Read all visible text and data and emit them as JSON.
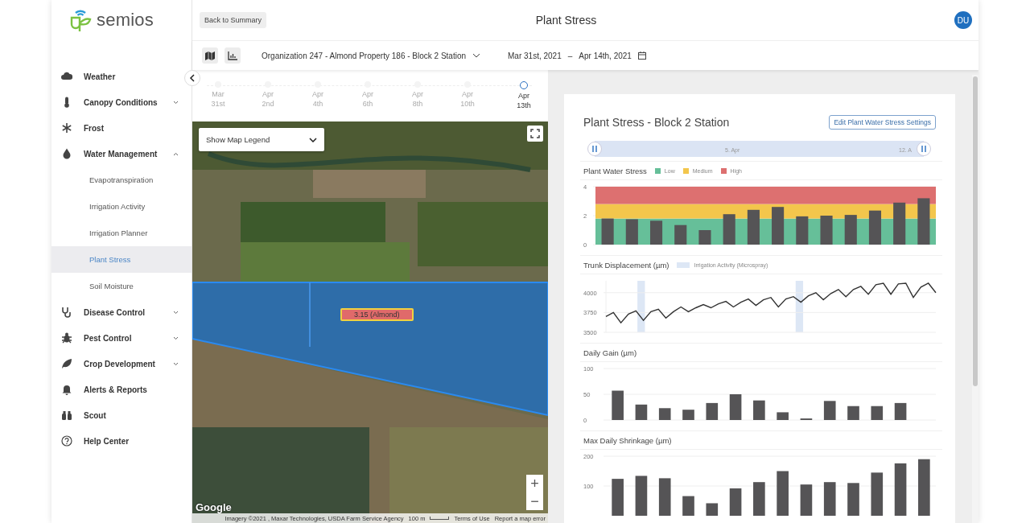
{
  "sidebar": {
    "logo_text": "semios",
    "items": [
      {
        "kind": "cloud",
        "label": "Weather",
        "has_submenu": false,
        "expanded": false
      },
      {
        "kind": "thermometer",
        "label": "Canopy Conditions",
        "has_submenu": true,
        "expanded": false
      },
      {
        "kind": "snowflake",
        "label": "Frost",
        "has_submenu": false,
        "expanded": false
      },
      {
        "kind": "drop",
        "label": "Water Management",
        "has_submenu": true,
        "expanded": true,
        "children": [
          {
            "label": "Evapotranspiration",
            "selected": false
          },
          {
            "label": "Irrigation Activity",
            "selected": false
          },
          {
            "label": "Irrigation Planner",
            "selected": false
          },
          {
            "label": "Plant Stress",
            "selected": true
          },
          {
            "label": "Soil Moisture",
            "selected": false
          }
        ]
      },
      {
        "kind": "stethoscope",
        "label": "Disease Control",
        "has_submenu": true,
        "expanded": false
      },
      {
        "kind": "bug",
        "label": "Pest Control",
        "has_submenu": true,
        "expanded": false
      },
      {
        "kind": "leaf",
        "label": "Crop Development",
        "has_submenu": true,
        "expanded": false
      },
      {
        "kind": "bell",
        "label": "Alerts & Reports",
        "has_submenu": false,
        "expanded": false
      },
      {
        "kind": "binoculars",
        "label": "Scout",
        "has_submenu": false,
        "expanded": false
      },
      {
        "kind": "help",
        "label": "Help Center",
        "has_submenu": false,
        "expanded": false
      }
    ]
  },
  "header": {
    "back_button": "Back to Summary",
    "title": "Plant Stress",
    "avatar": "DU"
  },
  "toolbar": {
    "location": "Organization 247 - Almond Property 186 - Block 2 Station",
    "date_start": "Mar 31st, 2021",
    "date_separator": "–",
    "date_end": "Apr 14th, 2021"
  },
  "timeline": [
    {
      "month": "Mar",
      "day": "31st",
      "selected": false
    },
    {
      "month": "Apr",
      "day": "2nd",
      "selected": false
    },
    {
      "month": "Apr",
      "day": "4th",
      "selected": false
    },
    {
      "month": "Apr",
      "day": "6th",
      "selected": false
    },
    {
      "month": "Apr",
      "day": "8th",
      "selected": false
    },
    {
      "month": "Apr",
      "day": "10th",
      "selected": false
    },
    {
      "month": "Apr",
      "day": "13th",
      "selected": true
    }
  ],
  "map": {
    "legend_toggle": "Show Map Legend",
    "block_label": "3.15 (Almond)",
    "zoom_in": "+",
    "zoom_out": "−",
    "provider": "Google",
    "attribution": "Imagery ©2021 , Maxar Technologies, USDA Farm Service Agency",
    "scale": "100 m",
    "terms": "Terms of Use",
    "report": "Report a map error"
  },
  "panel": {
    "title": "Plant Stress - Block 2 Station",
    "edit_button": "Edit Plant Water Stress Settings",
    "range_ticks": [
      "5. Apr",
      "12. A"
    ],
    "charts": [
      {
        "chart_data": {
          "type": "bar",
          "title": "Plant Water Stress",
          "ylim": [
            0,
            4
          ],
          "yticks": [
            0,
            2,
            4
          ],
          "categories": [
            null,
            null,
            null,
            null,
            null,
            null,
            null,
            null,
            null,
            null,
            null,
            null,
            null,
            null
          ],
          "values": [
            1.8,
            1.75,
            1.65,
            1.35,
            1.0,
            2.1,
            2.4,
            2.6,
            1.95,
            2.0,
            2.05,
            2.35,
            2.9,
            3.2
          ],
          "bands": [
            {
              "axis": "y",
              "from": 0,
              "to": 1.8,
              "label": "Low",
              "color": "#66bf99"
            },
            {
              "axis": "y",
              "from": 1.8,
              "to": 2.8,
              "label": "Medium",
              "color": "#f3c64c"
            },
            {
              "axis": "y",
              "from": 2.8,
              "to": 4,
              "label": "High",
              "color": "#dd7070"
            }
          ]
        }
      },
      {
        "legend": [
          {
            "label": "Irrigation Activity (Microspray)",
            "color": "#dde7f5"
          }
        ],
        "chart_data": {
          "type": "line",
          "title": "Trunk Displacement (µm)",
          "ylim": [
            3500,
            4150
          ],
          "yticks": [
            3500,
            3750,
            4000
          ],
          "categories": [
            null,
            null,
            null,
            null,
            null,
            null,
            null,
            null,
            null,
            null,
            null,
            null,
            null,
            null,
            null,
            null,
            null,
            null,
            null,
            null,
            null,
            null,
            null,
            null,
            null,
            null,
            null,
            null,
            null,
            null,
            null,
            null,
            null,
            null,
            null,
            null,
            null,
            null,
            null,
            null,
            null,
            null,
            null,
            null,
            null
          ],
          "series": [
            {
              "color": "#333333",
              "values": [
                3700,
                3750,
                3620,
                3730,
                3770,
                3650,
                3760,
                3790,
                3680,
                3760,
                3820,
                3760,
                3810,
                3850,
                3810,
                3860,
                3890,
                3820,
                3880,
                3920,
                3840,
                3910,
                3940,
                3820,
                3920,
                3950,
                3880,
                3960,
                4000,
                3910,
                3990,
                4040,
                3950,
                4040,
                4080,
                3980,
                4100,
                4120,
                3980,
                4110,
                4120,
                3940,
                4070,
                4120,
                4000
              ]
            }
          ]
        }
      },
      {
        "chart_data": {
          "type": "bar",
          "title": "Daily Gain (µm)",
          "ylim": [
            0,
            100
          ],
          "yticks": [
            0,
            50,
            100
          ],
          "categories": [
            null,
            null,
            null,
            null,
            null,
            null,
            null,
            null,
            null,
            null,
            null,
            null,
            null,
            null
          ],
          "values": [
            57,
            30,
            23,
            20,
            33,
            50,
            38,
            15,
            3,
            37,
            27,
            27,
            33,
            null
          ]
        }
      },
      {
        "chart_data": {
          "type": "bar",
          "title": "Max Daily Shrinkage (µm)",
          "ylim": [
            0,
            200
          ],
          "yticks": [
            100,
            200
          ],
          "categories": [
            null,
            null,
            null,
            null,
            null,
            null,
            null,
            null,
            null,
            null,
            null,
            null,
            null,
            null
          ],
          "values": [
            124,
            134,
            126,
            66,
            42,
            92,
            113,
            150,
            105,
            113,
            110,
            145,
            176,
            190
          ]
        }
      }
    ]
  }
}
